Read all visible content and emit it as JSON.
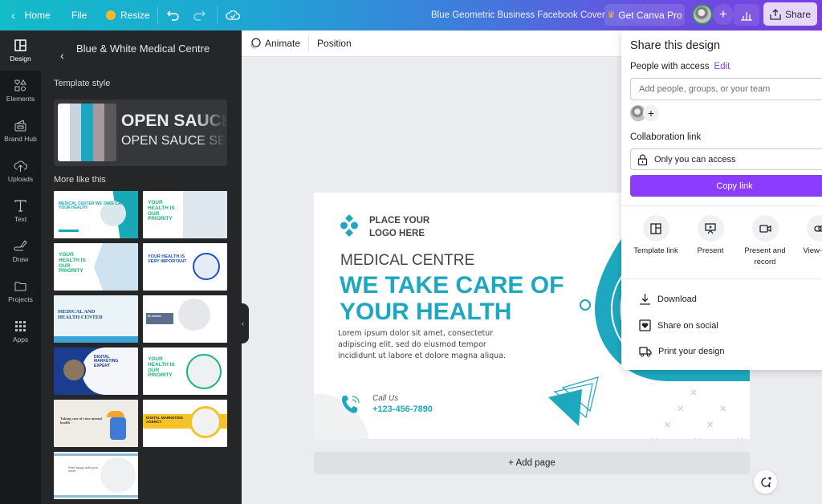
{
  "topbar": {
    "home_label": "Home",
    "file_label": "File",
    "resize_label": "Resize",
    "document_title": "Blue Geometric Business Facebook Cover",
    "pro_label": "Get Canva Pro",
    "share_label": "Share"
  },
  "rail": {
    "items": [
      {
        "label": "Design",
        "icon": "layout-icon",
        "active": true
      },
      {
        "label": "Elements",
        "icon": "shapes-icon"
      },
      {
        "label": "Brand Hub",
        "icon": "brand-icon"
      },
      {
        "label": "Uploads",
        "icon": "cloud-upload-icon"
      },
      {
        "label": "Text",
        "icon": "text-icon"
      },
      {
        "label": "Draw",
        "icon": "pen-icon"
      },
      {
        "label": "Projects",
        "icon": "folder-icon"
      },
      {
        "label": "Apps",
        "icon": "grid-icon"
      }
    ]
  },
  "panel": {
    "title": "Blue & White Medical Centre",
    "template_style_label": "Template style",
    "font_heading": "OPEN SAUCE",
    "font_body": "OPEN SAUCE SEMI",
    "swatches": [
      "#ffffff",
      "#c8d4dd",
      "#1ea8bf",
      "#a89a9a",
      "#595959"
    ],
    "more_label": "More like this",
    "thumbnails": [
      {
        "title": "MEDICAL CENTER WE TAKE CARE OF YOUR HEALTH",
        "accent": "#17a9b5"
      },
      {
        "title": "YOUR HEALTH IS OUR PRIORITY",
        "accent": "#19b37a"
      },
      {
        "title": "YOUR HEALTH IS OUR PRIORITY",
        "accent": "#19b37a"
      },
      {
        "title": "YOUR HEALTH IS VERY IMPORTANT",
        "accent": "#1f4fbf"
      },
      {
        "title": "MEDICAL AND HEALTH CENTER",
        "accent": "#1e4f7a"
      },
      {
        "title": "Dr. Doctor",
        "accent": "#5b6f8c"
      },
      {
        "title": "DIGITAL MARKETING EXPERT",
        "accent": "#1b3d8f"
      },
      {
        "title": "YOUR HEALTH IS OUR PRIORITY",
        "accent": "#19b37a"
      },
      {
        "title": "Taking care of your mental health",
        "accent": "#3a3a3a"
      },
      {
        "title": "DIGITAL MARKETING AGENCY",
        "accent": "#f5c228"
      },
      {
        "title": "Feel happy with your smile",
        "accent": "#8dbbd6"
      }
    ]
  },
  "context_bar": {
    "animate_label": "Animate",
    "position_label": "Position"
  },
  "design": {
    "logo_text_1": "PLACE YOUR",
    "logo_text_2": "LOGO HERE",
    "subtitle": "MEDICAL CENTRE",
    "headline_1": "WE TAKE CARE OF",
    "headline_2": "YOUR HEALTH",
    "body_1": "Lorem ipsum dolor sit amet, consectetur",
    "body_2": "adipiscing elit, sed do eiusmod tempor",
    "body_3": "incididunt ut labore et dolore magna aliqua.",
    "call_label": "Call Us",
    "phone": "+123-456-7890",
    "accent_color": "#1ea8bf"
  },
  "add_page_label": "+ Add page",
  "share_panel": {
    "title": "Share this design",
    "people_label": "People with access",
    "edit_label": "Edit",
    "input_placeholder": "Add people, groups, or your team",
    "collab_label": "Collaboration link",
    "access_value": "Only you can access",
    "copy_label": "Copy link",
    "options": [
      {
        "label": "Template link",
        "icon": "template-icon"
      },
      {
        "label": "Present",
        "icon": "present-icon"
      },
      {
        "label": "Present and record",
        "icon": "camera-icon"
      },
      {
        "label": "View-only",
        "icon": "link-icon"
      }
    ],
    "actions": [
      {
        "label": "Download",
        "icon": "download-icon"
      },
      {
        "label": "Share on social",
        "icon": "heart-icon"
      },
      {
        "label": "Print your design",
        "icon": "truck-icon"
      }
    ],
    "brand_color": "#8b3dff"
  }
}
